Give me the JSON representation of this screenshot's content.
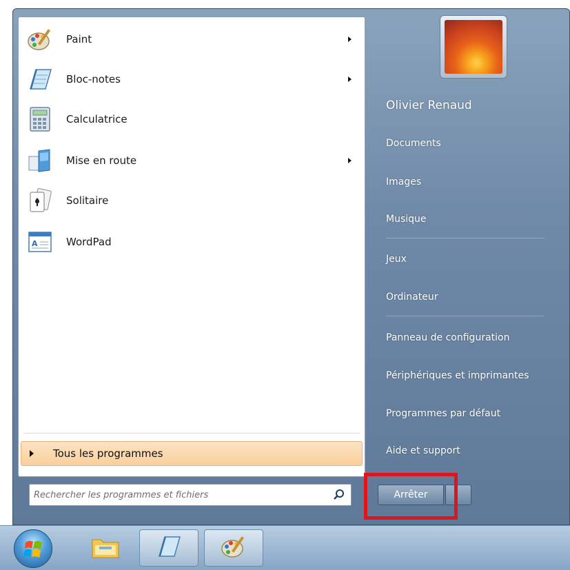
{
  "programs": [
    {
      "label": "Paint",
      "icon": "paint-palette-icon",
      "has_submenu": true
    },
    {
      "label": "Bloc-notes",
      "icon": "notepad-icon",
      "has_submenu": true
    },
    {
      "label": "Calculatrice",
      "icon": "calculator-icon",
      "has_submenu": false
    },
    {
      "label": "Mise en route",
      "icon": "getting-started-icon",
      "has_submenu": true
    },
    {
      "label": "Solitaire",
      "icon": "solitaire-cards-icon",
      "has_submenu": false
    },
    {
      "label": "WordPad",
      "icon": "wordpad-icon",
      "has_submenu": false
    }
  ],
  "all_programs_label": "Tous les programmes",
  "search": {
    "placeholder": "Rechercher les programmes et fichiers",
    "value": ""
  },
  "user": {
    "name": "Olivier Renaud"
  },
  "right_links": [
    "Documents",
    "Images",
    "Musique",
    "Jeux",
    "Ordinateur",
    "Panneau de configuration",
    "Périphériques et imprimantes",
    "Programmes par défaut",
    "Aide et support"
  ],
  "shutdown_label": "Arrêter",
  "colors": {
    "highlight": "#e0141c",
    "all_programs_bg": "#f9cf9c",
    "right_pane": "#6f8aa8"
  },
  "taskbar": [
    {
      "icon": "windows-start-orb-icon"
    },
    {
      "icon": "windows-explorer-folder-icon"
    },
    {
      "icon": "notepad-icon"
    },
    {
      "icon": "paint-palette-icon"
    }
  ]
}
